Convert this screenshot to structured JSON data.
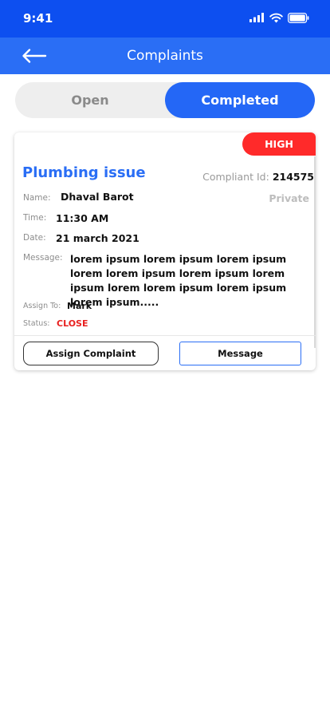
{
  "status_bar": {
    "time": "9:41",
    "icons": [
      "signal-icon",
      "wifi-icon",
      "battery-icon"
    ]
  },
  "app_bar": {
    "title": "Complaints",
    "back_icon": "back-arrow-icon"
  },
  "tabs": [
    {
      "label": "Open",
      "active": false
    },
    {
      "label": "Completed",
      "active": true
    }
  ],
  "complaint": {
    "priority": "HIGH",
    "title": "Plumbing issue",
    "id_label": "Compliant Id:",
    "id_value": "214575",
    "visibility": "Private",
    "name_label": "Name:",
    "name_value": "Dhaval Barot",
    "time_label": "Time:",
    "time_value": "11:30 AM",
    "date_label": "Date:",
    "date_value": "21 march 2021",
    "message_label": "Message:",
    "message_value": "lorem ipsum lorem ipsum lorem ipsum lorem lorem ipsum lorem ipsum lorem ipsum lorem lorem ipsum lorem ipsum lorem ipsum.....",
    "assign_label": "Assign To:",
    "assign_value": "Mark",
    "status_label": "Status:",
    "status_value": "CLOSE",
    "assign_button": "Assign Complaint",
    "message_button": "Message"
  },
  "colors": {
    "status_bar": "#0d4ff0",
    "app_bar": "#2a6ef5",
    "active_tab": "#2467f6",
    "priority_high": "#ff2a2a",
    "status_close": "#e8201f"
  }
}
